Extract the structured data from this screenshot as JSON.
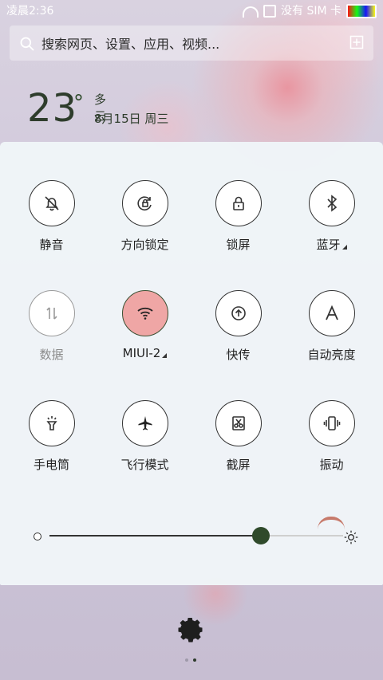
{
  "status": {
    "time": "凌晨2:36",
    "network": "没有 SIM 卡"
  },
  "search": {
    "placeholder": "搜索网页、设置、应用、视频..."
  },
  "weather": {
    "temperature": "23",
    "degree": "°",
    "description": "多云",
    "date": "8月15日 周三"
  },
  "toggles": [
    {
      "label": "静音",
      "icon": "bell-off-icon",
      "state": "off"
    },
    {
      "label": "方向锁定",
      "icon": "rotate-lock-icon",
      "state": "off"
    },
    {
      "label": "锁屏",
      "icon": "lock-icon",
      "state": "off"
    },
    {
      "label": "蓝牙",
      "icon": "bluetooth-icon",
      "state": "off",
      "has_sub": true
    },
    {
      "label": "数据",
      "icon": "data-arrows-icon",
      "state": "disabled"
    },
    {
      "label": "MIUI-2",
      "icon": "wifi-icon",
      "state": "on",
      "has_sub": true
    },
    {
      "label": "快传",
      "icon": "upload-circle-icon",
      "state": "off"
    },
    {
      "label": "自动亮度",
      "icon": "auto-brightness-icon",
      "state": "off"
    },
    {
      "label": "手电筒",
      "icon": "flashlight-icon",
      "state": "off"
    },
    {
      "label": "飞行模式",
      "icon": "airplane-icon",
      "state": "off"
    },
    {
      "label": "截屏",
      "icon": "screenshot-scissors-icon",
      "state": "off"
    },
    {
      "label": "振动",
      "icon": "vibrate-icon",
      "state": "off"
    }
  ],
  "brightness": {
    "value_fraction": 0.72
  },
  "colors": {
    "accent_dark": "#2f4a2b",
    "active_toggle": "#efa6a5",
    "panel": "#f0f5f8"
  },
  "pager": {
    "pages": 2,
    "current": 2
  }
}
